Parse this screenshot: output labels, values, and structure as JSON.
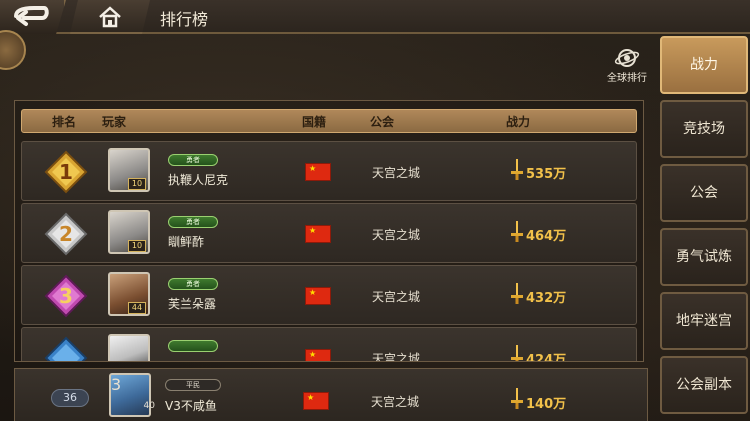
{
  "header": {
    "title": "排行榜"
  },
  "global_rank": {
    "label": "全球排行"
  },
  "table": {
    "columns": [
      "排名",
      "玩家",
      "国籍",
      "公会",
      "战力"
    ],
    "rows": [
      {
        "rank_badge": "1",
        "level": "10",
        "title": "勇者",
        "name": "执鞭人尼克",
        "guild": "天宫之城",
        "power": "535万"
      },
      {
        "rank_badge": "2",
        "level": "10",
        "title": "勇者",
        "name": "瞓鲆酢",
        "guild": "天宫之城",
        "power": "464万"
      },
      {
        "rank_badge": "3",
        "level": "44",
        "title": "勇者",
        "name": "芙兰朵露",
        "guild": "天宫之城",
        "power": "432万"
      },
      {
        "rank_badge": "",
        "level": "",
        "title": "",
        "name": "",
        "guild": "天宫之城",
        "power": "424万"
      }
    ]
  },
  "my_entry": {
    "rank": "36",
    "level": "3",
    "level_right": "40",
    "title": "平民",
    "name": "V3不咸鱼",
    "guild": "天宫之城",
    "power": "140万"
  },
  "tabs": [
    {
      "label": "战力",
      "active": true
    },
    {
      "label": "竞技场"
    },
    {
      "label": "公会"
    },
    {
      "label": "勇气试炼"
    },
    {
      "label": "地牢迷宫"
    },
    {
      "label": "公会副本"
    }
  ]
}
